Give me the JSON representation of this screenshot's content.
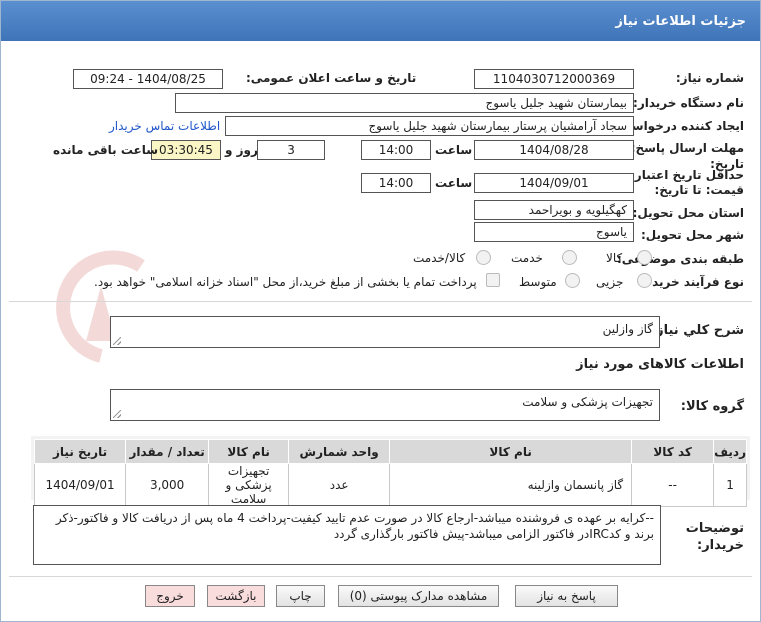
{
  "window": {
    "title": "جزئیات اطلاعات نیاز"
  },
  "form": {
    "need_number_label": "شماره نیاز:",
    "need_number": "1104030712000369",
    "announce_label": "تاریخ و ساعت اعلان عمومی:",
    "announce_value": "1404/08/25 - 09:24",
    "buyer_label": "نام دستگاه خریدار:",
    "buyer_value": "بیمارستان شهید جلیل یاسوج",
    "creator_label": "ایجاد کننده درخواست:",
    "creator_value": "سجاد آرامشیان پرستار بیمارستان شهید جلیل یاسوج",
    "contact_link": "اطلاعات تماس خریدار",
    "deadline_label_1": "مهلت ارسال پاسخ: تا",
    "deadline_label_2": "تاریخ:",
    "deadline_date": "1404/08/28",
    "time_label": "ساعت",
    "deadline_time": "14:00",
    "days_value": "3",
    "days_label": "روز و",
    "remaining_value": "03:30:45",
    "remaining_label": "ساعت باقی مانده",
    "validity_label_1": "حداقل تاریخ اعتبار",
    "validity_label_2": "قیمت: تا تاریخ:",
    "validity_date": "1404/09/01",
    "validity_time_label": "ساعت",
    "validity_time": "14:00",
    "province_label": "استان محل تحویل:",
    "province_value": "کهگیلویه و بویراحمد",
    "city_label": "شهر محل تحویل:",
    "city_value": "یاسوج",
    "category_label": "طبقه بندی موضوعی:",
    "category_options": [
      "کالا",
      "خدمت",
      "کالا/خدمت"
    ],
    "process_label": "نوع فرآیند خرید :",
    "process_options": [
      "جزیی",
      "متوسط"
    ],
    "payment_text": "پرداخت تمام یا بخشی از مبلغ خرید،از محل \"اسناد خزانه اسلامی\" خواهد بود."
  },
  "description": {
    "label": "شرح كلي نياز:",
    "value": "گاز وازلین"
  },
  "goods_info": {
    "label": "اطلاعات کالاهای مورد نیاز",
    "group_label": "گروه کالا:",
    "group_value": "تجهیزات پزشکی و سلامت"
  },
  "table": {
    "headers": [
      "ردیف",
      "کد کالا",
      "نام کالا",
      "واحد شمارش",
      "نام کالا",
      "تعداد / مقدار",
      "تاریخ نیاز"
    ],
    "rows": [
      {
        "row": "1",
        "code": "--",
        "name": "گاز پانسمان وازلینه",
        "unit": "عدد",
        "group": "تجهیزات پزشکی و سلامت",
        "qty": "3,000",
        "date": "1404/09/01"
      }
    ]
  },
  "buyer_notes": {
    "label_1": "توضیحات",
    "label_2": "خریدار:",
    "value": "--کرایه بر عهده ی فروشنده میباشد-ارجاع کالا در صورت عدم تایید کیفیت-پرداخت 4 ماه پس از دریافت کالا و فاکتور-ذکر برند و کدIRCدر فاکتور الزامی میباشد-پیش فاکتور بارگذاری گردد"
  },
  "buttons": {
    "reply": "پاسخ به نیاز",
    "docs": "مشاهده مدارک پیوستی (0)",
    "print": "چاپ",
    "back": "بازگشت",
    "exit": "خروج"
  },
  "colors": {
    "titlebar": "#4a80c4",
    "link": "#1f56c9",
    "remaining_bg": "#fbf6c6",
    "watermark": "#c0392b"
  }
}
